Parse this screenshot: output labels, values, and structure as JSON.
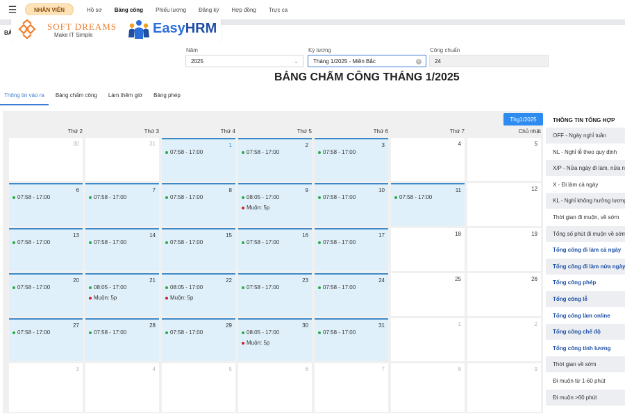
{
  "nav": {
    "role": "NHÂN VIÊN",
    "items": [
      "Hồ sơ",
      "Bảng công",
      "Phiếu lương",
      "Đăng ký",
      "Hợp đồng",
      "Trực ca"
    ],
    "active_index": 1
  },
  "breadcrumb": "BẢ",
  "logo": {
    "softdreams_name": "SOFT DREAMS",
    "softdreams_tagline": "Make IT Simple",
    "easyhrm_prefix": "Easy",
    "easyhrm_suffix": "HRM"
  },
  "filters": {
    "year_label": "Năm",
    "year_value": "2025",
    "period_label": "Kỳ lương",
    "period_value": "Tháng 1/2025 - Miền Bắc",
    "standard_label": "Công chuẩn",
    "standard_value": "24"
  },
  "title": "BẢNG CHẤM CÔNG THÁNG 1/2025",
  "tabs": [
    "Thông tin vào ra",
    "Bảng chấm công",
    "Làm thêm giờ",
    "Bảng phép"
  ],
  "active_tab": 0,
  "calendar": {
    "month_button": "Thg1/2025",
    "weekdays": [
      "Thứ 2",
      "Thứ 3",
      "Thứ 4",
      "Thứ 5",
      "Thứ 6",
      "Thứ 7",
      "Chủ nhật"
    ],
    "weeks": [
      [
        {
          "day": "30",
          "muted": true,
          "work": false,
          "entries": []
        },
        {
          "day": "31",
          "muted": true,
          "work": false,
          "entries": []
        },
        {
          "day": "1",
          "muted": false,
          "today": true,
          "work": true,
          "entries": [
            {
              "text": "07:58 - 17:00",
              "type": "ok"
            }
          ]
        },
        {
          "day": "2",
          "muted": false,
          "work": true,
          "entries": [
            {
              "text": "07:58 - 17:00",
              "type": "ok"
            }
          ]
        },
        {
          "day": "3",
          "muted": false,
          "work": true,
          "entries": [
            {
              "text": "07:58 - 17:00",
              "type": "ok"
            }
          ]
        },
        {
          "day": "4",
          "muted": false,
          "work": false,
          "entries": []
        },
        {
          "day": "5",
          "muted": false,
          "work": false,
          "entries": []
        }
      ],
      [
        {
          "day": "6",
          "muted": false,
          "work": true,
          "entries": [
            {
              "text": "07:58 - 17:00",
              "type": "ok"
            }
          ]
        },
        {
          "day": "7",
          "muted": false,
          "work": true,
          "entries": [
            {
              "text": "07:58 - 17:00",
              "type": "ok"
            }
          ]
        },
        {
          "day": "8",
          "muted": false,
          "work": true,
          "entries": [
            {
              "text": "07:58 - 17:00",
              "type": "ok"
            }
          ]
        },
        {
          "day": "9",
          "muted": false,
          "work": true,
          "entries": [
            {
              "text": "08:05 - 17:00",
              "type": "ok"
            },
            {
              "text": "Muộn: 5p",
              "type": "late"
            }
          ]
        },
        {
          "day": "10",
          "muted": false,
          "work": true,
          "entries": [
            {
              "text": "07:58 - 17:00",
              "type": "ok"
            }
          ]
        },
        {
          "day": "11",
          "muted": false,
          "work": true,
          "entries": [
            {
              "text": "07:58 - 17:00",
              "type": "ok"
            }
          ]
        },
        {
          "day": "12",
          "muted": false,
          "work": false,
          "entries": []
        }
      ],
      [
        {
          "day": "13",
          "muted": false,
          "work": true,
          "entries": [
            {
              "text": "07:58 - 17:00",
              "type": "ok"
            }
          ]
        },
        {
          "day": "14",
          "muted": false,
          "work": true,
          "entries": [
            {
              "text": "07:58 - 17:00",
              "type": "ok"
            }
          ]
        },
        {
          "day": "15",
          "muted": false,
          "work": true,
          "entries": [
            {
              "text": "07:58 - 17:00",
              "type": "ok"
            }
          ]
        },
        {
          "day": "16",
          "muted": false,
          "work": true,
          "entries": [
            {
              "text": "07:58 - 17:00",
              "type": "ok"
            }
          ]
        },
        {
          "day": "17",
          "muted": false,
          "work": true,
          "entries": [
            {
              "text": "07:58 - 17:00",
              "type": "ok"
            }
          ]
        },
        {
          "day": "18",
          "muted": false,
          "work": false,
          "entries": []
        },
        {
          "day": "19",
          "muted": false,
          "work": false,
          "entries": []
        }
      ],
      [
        {
          "day": "20",
          "muted": false,
          "work": true,
          "entries": [
            {
              "text": "07:58 - 17:00",
              "type": "ok"
            }
          ]
        },
        {
          "day": "21",
          "muted": false,
          "work": true,
          "entries": [
            {
              "text": "08:05 - 17:00",
              "type": "ok"
            },
            {
              "text": "Muộn: 5p",
              "type": "late"
            }
          ]
        },
        {
          "day": "22",
          "muted": false,
          "work": true,
          "entries": [
            {
              "text": "08:05 - 17:00",
              "type": "ok"
            },
            {
              "text": "Muộn: 5p",
              "type": "late"
            }
          ]
        },
        {
          "day": "23",
          "muted": false,
          "work": true,
          "entries": [
            {
              "text": "07:58 - 17:00",
              "type": "ok"
            }
          ]
        },
        {
          "day": "24",
          "muted": false,
          "work": true,
          "entries": [
            {
              "text": "07:58 - 17:00",
              "type": "ok"
            }
          ]
        },
        {
          "day": "25",
          "muted": false,
          "work": false,
          "entries": []
        },
        {
          "day": "26",
          "muted": false,
          "work": false,
          "entries": []
        }
      ],
      [
        {
          "day": "27",
          "muted": false,
          "work": true,
          "entries": [
            {
              "text": "07:58 - 17:00",
              "type": "ok"
            }
          ]
        },
        {
          "day": "28",
          "muted": false,
          "work": true,
          "entries": [
            {
              "text": "07:58 - 17:00",
              "type": "ok"
            }
          ]
        },
        {
          "day": "29",
          "muted": false,
          "work": true,
          "entries": [
            {
              "text": "07:58 - 17:00",
              "type": "ok"
            }
          ]
        },
        {
          "day": "30",
          "muted": false,
          "work": true,
          "entries": [
            {
              "text": "08:05 - 17:00",
              "type": "ok"
            },
            {
              "text": "Muộn: 5p",
              "type": "late"
            }
          ]
        },
        {
          "day": "31",
          "muted": false,
          "work": true,
          "entries": [
            {
              "text": "07:58 - 17:00",
              "type": "ok"
            }
          ]
        },
        {
          "day": "1",
          "muted": true,
          "work": false,
          "entries": []
        },
        {
          "day": "2",
          "muted": true,
          "work": false,
          "entries": []
        }
      ],
      [
        {
          "day": "3",
          "muted": true,
          "work": false,
          "entries": []
        },
        {
          "day": "4",
          "muted": true,
          "work": false,
          "entries": []
        },
        {
          "day": "5",
          "muted": true,
          "work": false,
          "entries": []
        },
        {
          "day": "6",
          "muted": true,
          "work": false,
          "entries": []
        },
        {
          "day": "7",
          "muted": true,
          "work": false,
          "entries": []
        },
        {
          "day": "8",
          "muted": true,
          "work": false,
          "entries": []
        },
        {
          "day": "9",
          "muted": true,
          "work": false,
          "entries": []
        }
      ]
    ]
  },
  "summary": {
    "title": "THÔNG TIN TỔNG HỢP",
    "rows": [
      {
        "label": "OFF - Ngày nghỉ tuần",
        "link": false
      },
      {
        "label": "NL - Nghỉ lễ theo quy định",
        "link": false
      },
      {
        "label": "X/P - Nửa ngày đi làm, nửa ngày",
        "link": false
      },
      {
        "label": "X - Đi làm cả ngày",
        "link": false
      },
      {
        "label": "KL - Nghỉ không hưởng lương",
        "link": false
      },
      {
        "label": "Thời gian đi muộn, về sớm",
        "link": false
      },
      {
        "label": "Tổng số phút đi muộn về sớm",
        "link": false
      },
      {
        "label": "Tổng công đi làm cả ngày",
        "link": true
      },
      {
        "label": "Tổng công đi làm nửa ngày",
        "link": true
      },
      {
        "label": "Tổng công phép",
        "link": true
      },
      {
        "label": "Tổng công lễ",
        "link": true
      },
      {
        "label": "Tổng công làm online",
        "link": true
      },
      {
        "label": "Tổng công chế độ",
        "link": true
      },
      {
        "label": "Tổng công tính lương",
        "link": true
      },
      {
        "label": "Thời gian về sớm",
        "link": false
      },
      {
        "label": "Đi muộn từ 1-60 phút",
        "link": false
      },
      {
        "label": "Đi muộn >60 phút",
        "link": false
      }
    ]
  },
  "colors": {
    "accent": "#2e8bef",
    "work_day_bg": "#dff0fa",
    "work_day_border": "#3e8ac9",
    "ok_dot": "#2eaa45",
    "late_dot": "#d02020",
    "summary_link": "#1f50a5",
    "role_badge_bg": "#fde3b7",
    "softdreams_orange": "#f07d2b",
    "easyhrm_blue": "#1f4fa3"
  }
}
